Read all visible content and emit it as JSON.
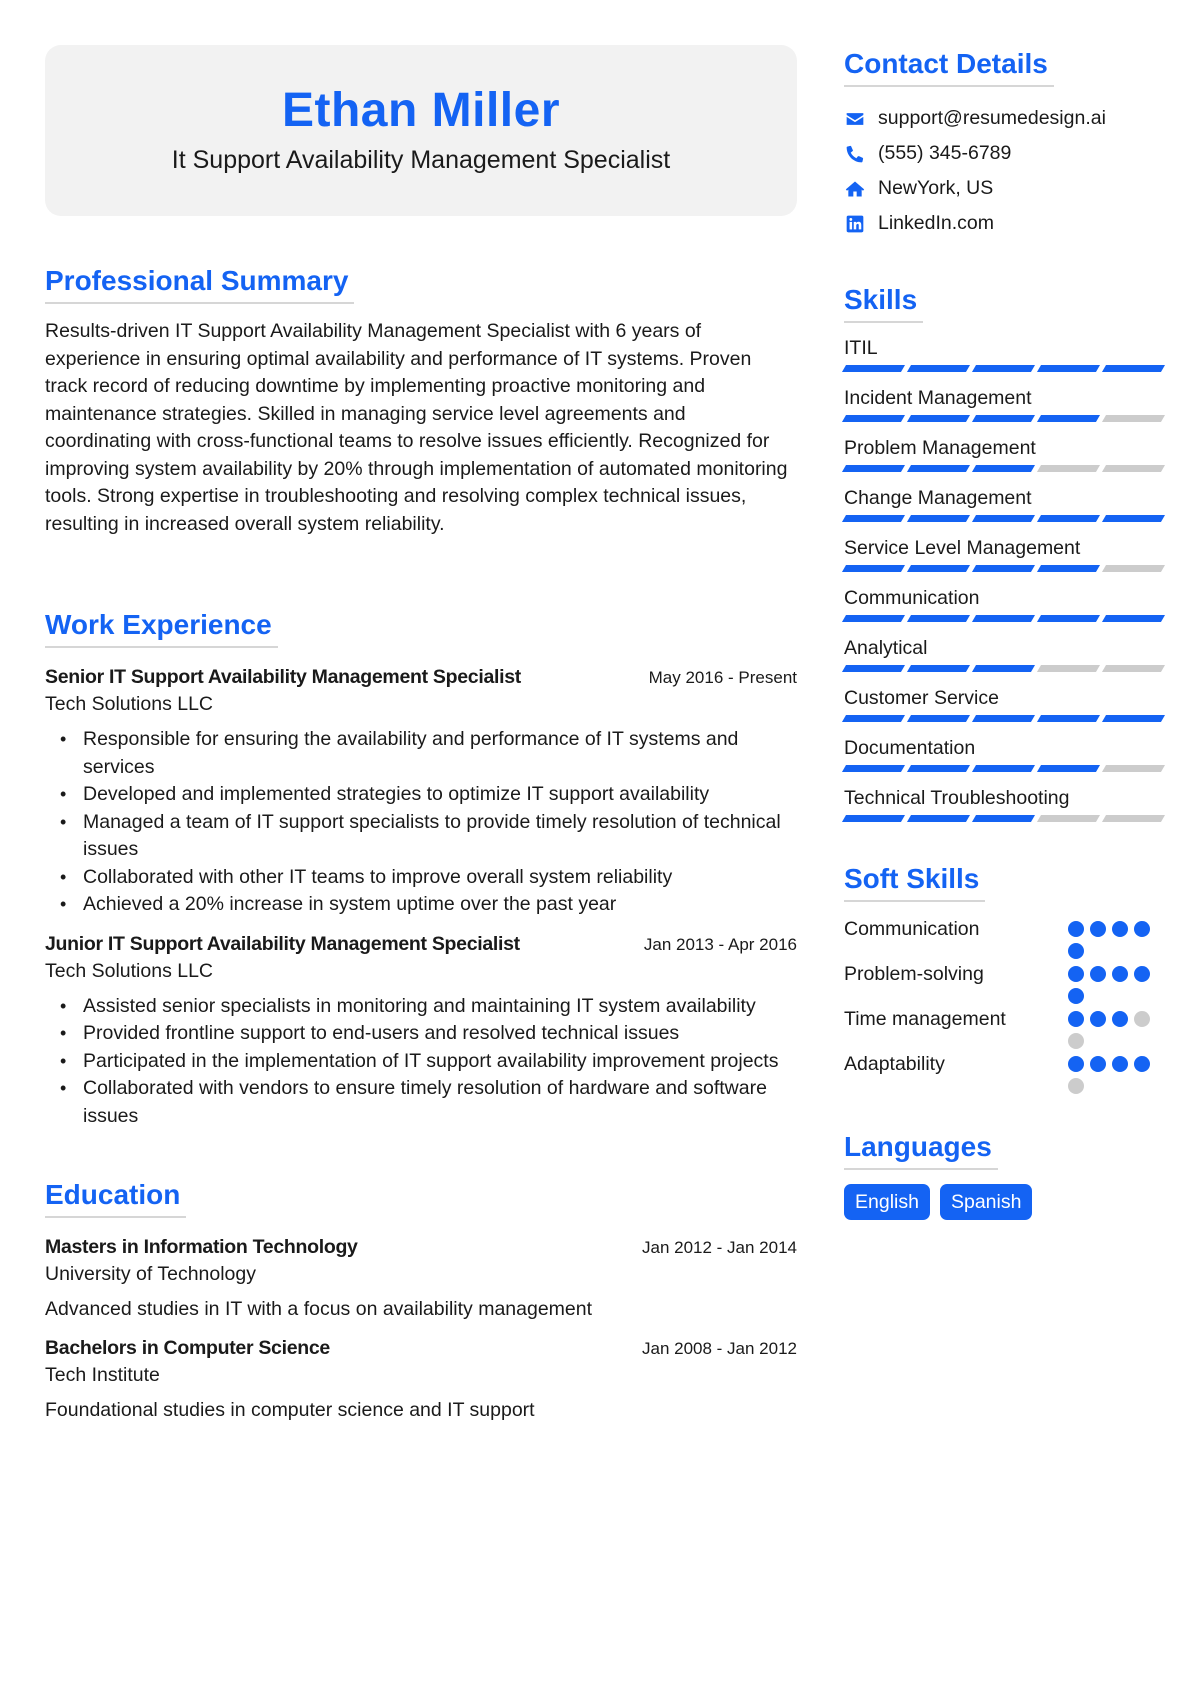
{
  "header": {
    "name": "Ethan Miller",
    "title": "It Support Availability Management Specialist"
  },
  "summary": {
    "heading": "Professional Summary",
    "text": "Results-driven IT Support Availability Management Specialist with 6 years of experience in ensuring optimal availability and performance of IT systems. Proven track record of reducing downtime by implementing proactive monitoring and maintenance strategies. Skilled in managing service level agreements and coordinating with cross-functional teams to resolve issues efficiently. Recognized for improving system availability by 20% through implementation of automated monitoring tools. Strong expertise in troubleshooting and resolving complex technical issues, resulting in increased overall system reliability."
  },
  "work": {
    "heading": "Work Experience",
    "jobs": [
      {
        "title": "Senior IT Support Availability Management Specialist",
        "dates": "May 2016 - Present",
        "company": "Tech Solutions LLC",
        "bullets": [
          "Responsible for ensuring the availability and performance of IT systems and services",
          "Developed and implemented strategies to optimize IT support availability",
          "Managed a team of IT support specialists to provide timely resolution of technical issues",
          "Collaborated with other IT teams to improve overall system reliability",
          "Achieved a 20% increase in system uptime over the past year"
        ]
      },
      {
        "title": "Junior IT Support Availability Management Specialist",
        "dates": "Jan 2013 - Apr 2016",
        "company": "Tech Solutions LLC",
        "bullets": [
          "Assisted senior specialists in monitoring and maintaining IT system availability",
          "Provided frontline support to end-users and resolved technical issues",
          "Participated in the implementation of IT support availability improvement projects",
          "Collaborated with vendors to ensure timely resolution of hardware and software issues"
        ]
      }
    ]
  },
  "education": {
    "heading": "Education",
    "items": [
      {
        "degree": "Masters in Information Technology",
        "dates": "Jan 2012 - Jan 2014",
        "school": "University of Technology",
        "description": "Advanced studies in IT with a focus on availability management"
      },
      {
        "degree": "Bachelors in Computer Science",
        "dates": "Jan 2008 - Jan 2012",
        "school": "Tech Institute",
        "description": "Foundational studies in computer science and IT support"
      }
    ]
  },
  "contact": {
    "heading": "Contact Details",
    "items": [
      {
        "icon": "envelope-icon",
        "text": "support@resumedesign.ai"
      },
      {
        "icon": "phone-icon",
        "text": "(555) 345-6789"
      },
      {
        "icon": "home-icon",
        "text": "NewYork, US"
      },
      {
        "icon": "linkedin-icon",
        "text": "LinkedIn.com"
      }
    ]
  },
  "skills": {
    "heading": "Skills",
    "max": 5,
    "items": [
      {
        "name": "ITIL",
        "level": 5
      },
      {
        "name": "Incident Management",
        "level": 4
      },
      {
        "name": "Problem Management",
        "level": 3
      },
      {
        "name": "Change Management",
        "level": 5
      },
      {
        "name": "Service Level Management",
        "level": 4
      },
      {
        "name": "Communication",
        "level": 5
      },
      {
        "name": "Analytical",
        "level": 3
      },
      {
        "name": "Customer Service",
        "level": 5
      },
      {
        "name": "Documentation",
        "level": 4
      },
      {
        "name": "Technical Troubleshooting",
        "level": 3
      }
    ]
  },
  "soft_skills": {
    "heading": "Soft Skills",
    "max": 5,
    "items": [
      {
        "name": "Communication",
        "level": 5
      },
      {
        "name": "Problem-solving",
        "level": 5
      },
      {
        "name": "Time management",
        "level": 3
      },
      {
        "name": "Adaptability",
        "level": 4
      }
    ]
  },
  "languages": {
    "heading": "Languages",
    "items": [
      "English",
      "Spanish"
    ]
  },
  "colors": {
    "accent": "#1463f3",
    "inactive": "#cccccc",
    "header_bg": "#f2f2f2"
  }
}
